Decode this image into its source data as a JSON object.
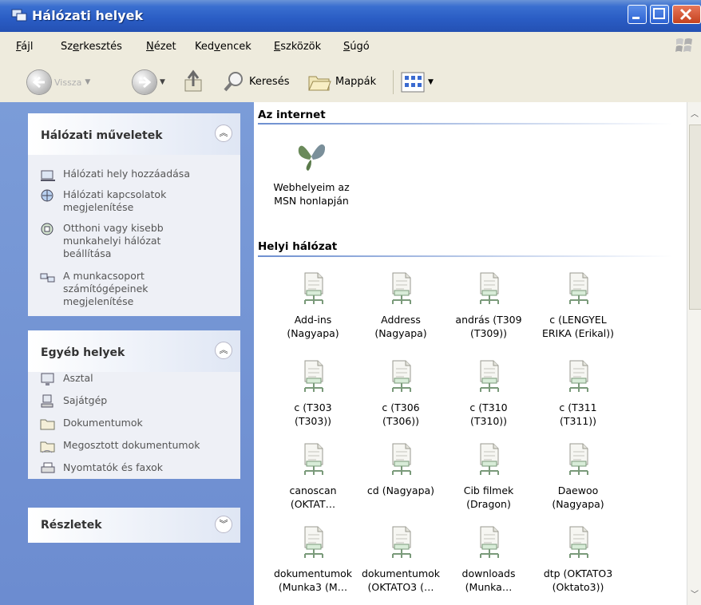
{
  "window": {
    "title": "Hálózati helyek"
  },
  "menu": [
    {
      "pre": "",
      "u": "F",
      "post": "ájl"
    },
    {
      "pre": "Sz",
      "u": "e",
      "post": "rkesztés"
    },
    {
      "pre": "",
      "u": "N",
      "post": "ézet"
    },
    {
      "pre": "Ked",
      "u": "v",
      "post": "encek"
    },
    {
      "pre": "",
      "u": "E",
      "post": "szközök"
    },
    {
      "pre": "",
      "u": "S",
      "post": "úgó"
    }
  ],
  "toolbar": {
    "back_label": "Vissza",
    "search_label": "Keresés",
    "folders_label": "Mappák"
  },
  "panels": {
    "network_tasks": {
      "title": "Hálózati műveletek",
      "items": [
        {
          "label": "Hálózati hely hozzáadása",
          "icon": "add-network-place-icon"
        },
        {
          "label": "Hálózati kapcsolatok megjelenítése",
          "icon": "network-connections-icon"
        },
        {
          "label": "Otthoni vagy kisebb munkahelyi hálózat beállítása",
          "icon": "home-network-wizard-icon"
        },
        {
          "label": "A munkacsoport számítógépeinek megjelenítése",
          "icon": "workgroup-computers-icon"
        }
      ]
    },
    "other_places": {
      "title": "Egyéb helyek",
      "items": [
        {
          "label": "Asztal",
          "icon": "desktop-icon"
        },
        {
          "label": "Sajátgép",
          "icon": "my-computer-icon"
        },
        {
          "label": "Dokumentumok",
          "icon": "documents-folder-icon"
        },
        {
          "label": "Megosztott dokumentumok",
          "icon": "shared-documents-icon"
        },
        {
          "label": "Nyomtatók és faxok",
          "icon": "printers-faxes-icon"
        }
      ]
    },
    "details": {
      "title": "Részletek"
    }
  },
  "content": {
    "internet_title": "Az internet",
    "internet_item": {
      "line1": "Webhelyeim az",
      "line2": "MSN honlapján"
    },
    "lan_title": "Helyi hálózat",
    "shares": [
      {
        "line1": "Add-ins",
        "line2": "(Nagyapa)"
      },
      {
        "line1": "Address",
        "line2": "(Nagyapa)"
      },
      {
        "line1": "andrás (T309",
        "line2": "(T309))"
      },
      {
        "line1": "c (LENGYEL",
        "line2": "ERIKA (Erikal))"
      },
      {
        "line1": "c (T303",
        "line2": "(T303))"
      },
      {
        "line1": "c (T306",
        "line2": "(T306))"
      },
      {
        "line1": "c (T310",
        "line2": "(T310))"
      },
      {
        "line1": "c (T311",
        "line2": "(T311))"
      },
      {
        "line1": "canoscan",
        "line2": "(OKTAT…"
      },
      {
        "line1": "cd (Nagyapa)",
        "line2": ""
      },
      {
        "line1": "Cib filmek",
        "line2": "(Dragon)"
      },
      {
        "line1": "Daewoo",
        "line2": "(Nagyapa)"
      },
      {
        "line1": "dokumentumok",
        "line2": "(Munka3 (M…"
      },
      {
        "line1": "dokumentumok",
        "line2": "(OKTATO3 (…"
      },
      {
        "line1": "downloads",
        "line2": "(Munka…"
      },
      {
        "line1": "dtp (OKTATO3",
        "line2": "(Oktato3))"
      }
    ]
  }
}
